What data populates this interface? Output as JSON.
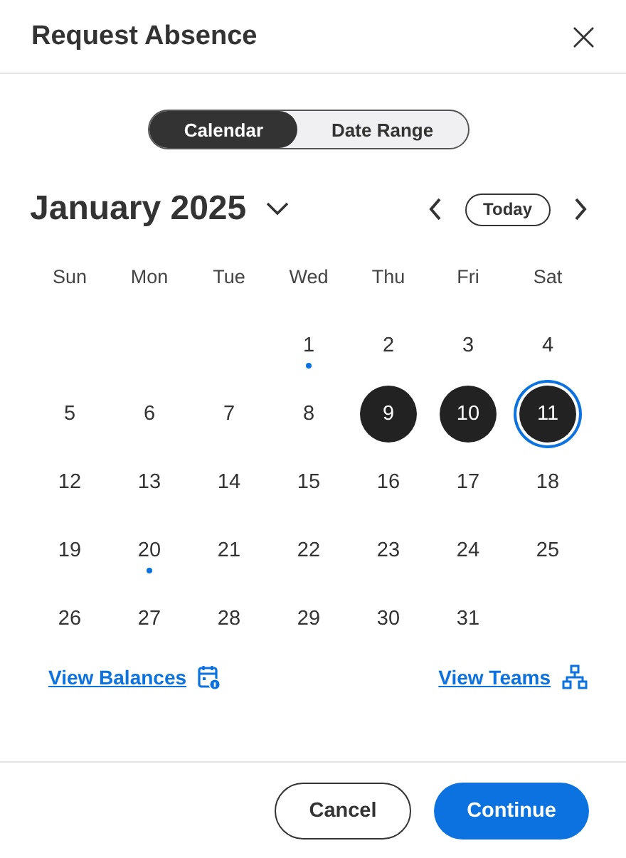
{
  "dialog": {
    "title": "Request Absence",
    "close": "×"
  },
  "view_toggle": [
    {
      "label": "Calendar",
      "selected": true
    },
    {
      "label": "Date Range",
      "selected": false
    }
  ],
  "month": {
    "title": "January 2025",
    "today": "Today"
  },
  "weekdays": [
    "Sun",
    "Mon",
    "Tue",
    "Wed",
    "Thu",
    "Fri",
    "Sat"
  ],
  "days": [
    {
      "kind": "blank"
    },
    {
      "kind": "blank"
    },
    {
      "kind": "blank"
    },
    {
      "kind": "day",
      "label": "1",
      "selected": false,
      "focused": false,
      "marked": true
    },
    {
      "kind": "day",
      "label": "2",
      "selected": false,
      "focused": false,
      "marked": false
    },
    {
      "kind": "day",
      "label": "3",
      "selected": false,
      "focused": false,
      "marked": false
    },
    {
      "kind": "day",
      "label": "4",
      "selected": false,
      "focused": false,
      "marked": false
    },
    {
      "kind": "day",
      "label": "5",
      "selected": false,
      "focused": false,
      "marked": false
    },
    {
      "kind": "day",
      "label": "6",
      "selected": false,
      "focused": false,
      "marked": false
    },
    {
      "kind": "day",
      "label": "7",
      "selected": false,
      "focused": false,
      "marked": false
    },
    {
      "kind": "day",
      "label": "8",
      "selected": false,
      "focused": false,
      "marked": false
    },
    {
      "kind": "day",
      "label": "9",
      "selected": true,
      "focused": false,
      "marked": false
    },
    {
      "kind": "day",
      "label": "10",
      "selected": true,
      "focused": false,
      "marked": false
    },
    {
      "kind": "day",
      "label": "11",
      "selected": true,
      "focused": true,
      "marked": false
    },
    {
      "kind": "day",
      "label": "12",
      "selected": false,
      "focused": false,
      "marked": false
    },
    {
      "kind": "day",
      "label": "13",
      "selected": false,
      "focused": false,
      "marked": false
    },
    {
      "kind": "day",
      "label": "14",
      "selected": false,
      "focused": false,
      "marked": false
    },
    {
      "kind": "day",
      "label": "15",
      "selected": false,
      "focused": false,
      "marked": false
    },
    {
      "kind": "day",
      "label": "16",
      "selected": false,
      "focused": false,
      "marked": false
    },
    {
      "kind": "day",
      "label": "17",
      "selected": false,
      "focused": false,
      "marked": false
    },
    {
      "kind": "day",
      "label": "18",
      "selected": false,
      "focused": false,
      "marked": false
    },
    {
      "kind": "day",
      "label": "19",
      "selected": false,
      "focused": false,
      "marked": false
    },
    {
      "kind": "day",
      "label": "20",
      "selected": false,
      "focused": false,
      "marked": true
    },
    {
      "kind": "day",
      "label": "21",
      "selected": false,
      "focused": false,
      "marked": false
    },
    {
      "kind": "day",
      "label": "22",
      "selected": false,
      "focused": false,
      "marked": false
    },
    {
      "kind": "day",
      "label": "23",
      "selected": false,
      "focused": false,
      "marked": false
    },
    {
      "kind": "day",
      "label": "24",
      "selected": false,
      "focused": false,
      "marked": false
    },
    {
      "kind": "day",
      "label": "25",
      "selected": false,
      "focused": false,
      "marked": false
    },
    {
      "kind": "day",
      "label": "26",
      "selected": false,
      "focused": false,
      "marked": false
    },
    {
      "kind": "day",
      "label": "27",
      "selected": false,
      "focused": false,
      "marked": false
    },
    {
      "kind": "day",
      "label": "28",
      "selected": false,
      "focused": false,
      "marked": false
    },
    {
      "kind": "day",
      "label": "29",
      "selected": false,
      "focused": false,
      "marked": false
    },
    {
      "kind": "day",
      "label": "30",
      "selected": false,
      "focused": false,
      "marked": false
    },
    {
      "kind": "day",
      "label": "31",
      "selected": false,
      "focused": false,
      "marked": false
    }
  ],
  "links": [
    {
      "label": "View Balances",
      "kind": "calendar"
    },
    {
      "label": "View Teams",
      "kind": "teams"
    }
  ],
  "buttons": [
    {
      "label": "Cancel",
      "kind": "secondary"
    },
    {
      "label": "Continue",
      "kind": "primary"
    }
  ]
}
